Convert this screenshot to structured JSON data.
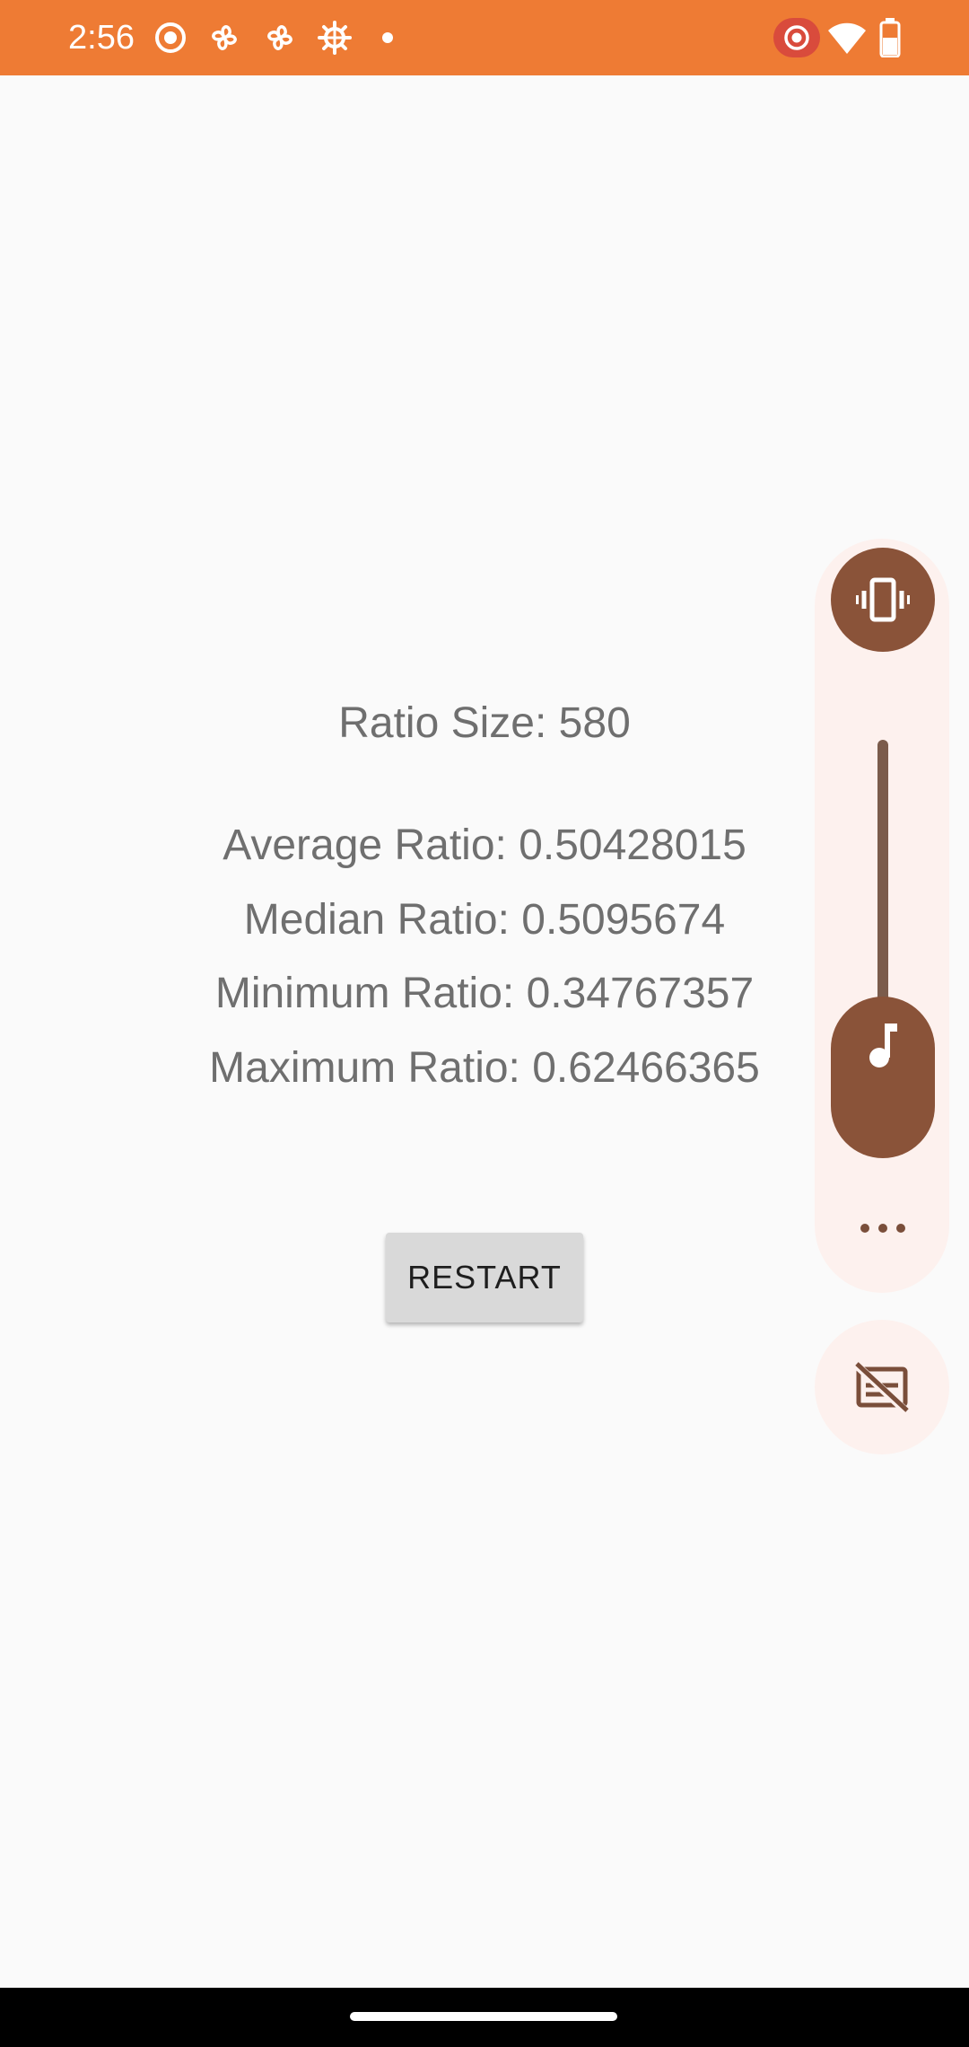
{
  "status_bar": {
    "time": "2:56",
    "background_color": "#ee7b34",
    "left_icons": [
      "record-icon",
      "fan-icon",
      "fan-icon",
      "gear-icon",
      "dot-icon"
    ],
    "right_icons": [
      "screen-record-icon",
      "wifi-icon",
      "battery-icon"
    ]
  },
  "stats": {
    "ratio_size": "Ratio Size: 580",
    "average_ratio": "Average Ratio: 0.50428015",
    "median_ratio": "Median Ratio: 0.5095674",
    "minimum_ratio": "Minimum Ratio: 0.34767357",
    "maximum_ratio": "Maximum Ratio: 0.62466365"
  },
  "restart_button": {
    "label": "RESTART"
  },
  "volume_panel": {
    "accent_color": "#8a5339",
    "panel_color": "#fdf1ee",
    "ringer_mode_icon": "vibrate-icon",
    "stream_icon": "music-note-icon",
    "more_icon": "more-horiz-icon",
    "captions_icon": "captions-off-icon"
  },
  "nav_bar": {
    "type": "gesture"
  }
}
